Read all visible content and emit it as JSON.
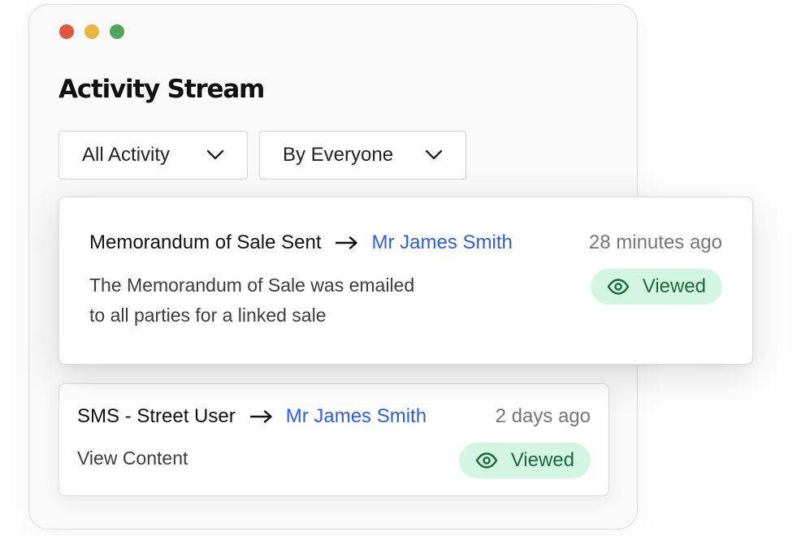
{
  "window": {
    "title": "Activity Stream",
    "controls": [
      "close",
      "minimize",
      "maximize"
    ]
  },
  "filters": {
    "activity": {
      "selected": "All Activity",
      "icon": "chevron-down-icon"
    },
    "person": {
      "selected": "By Everyone",
      "icon": "chevron-down-icon"
    }
  },
  "activities": [
    {
      "event": "Memorandum of Sale Sent",
      "recipient": "Mr James Smith",
      "time": "28 minutes ago",
      "description_lines": [
        "The Memorandum of Sale was emailed",
        "to all parties for a linked sale"
      ],
      "status": "Viewed"
    },
    {
      "event": "SMS - Street User",
      "recipient": "Mr James Smith",
      "time": "2 days ago",
      "description_lines": [
        "View Content"
      ],
      "status": "Viewed"
    }
  ],
  "colors": {
    "accent": "#2b5ee6",
    "badge_bg": "#d3f6e2",
    "badge_text": "#1a6a3d",
    "dot_red": "#e0573e",
    "dot_yellow": "#e9b63f",
    "dot_green": "#4fa65b"
  }
}
